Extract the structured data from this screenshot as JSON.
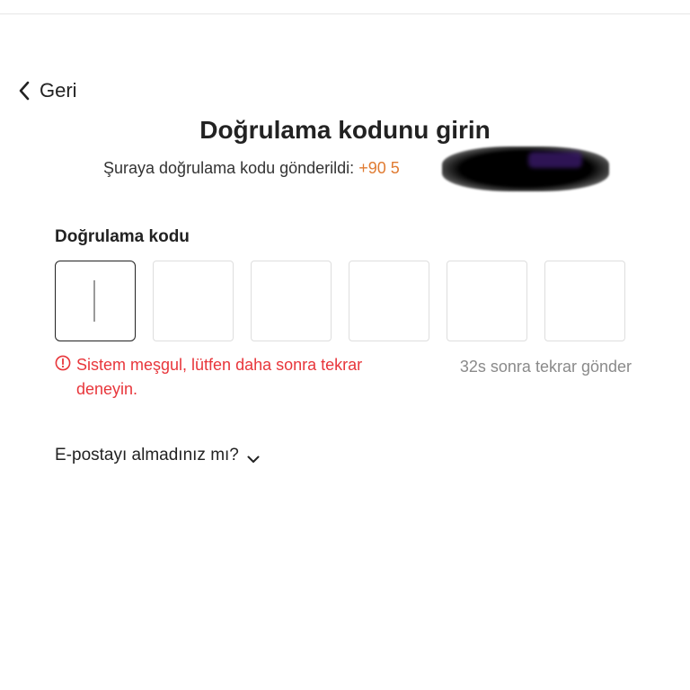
{
  "nav": {
    "back_label": "Geri",
    "back_icon": "chevron-left-icon"
  },
  "header": {
    "title": "Doğrulama kodunu girin",
    "subtitle_prefix": "Şuraya doğrulama kodu gönderildi:",
    "phone_visible": "+90 5"
  },
  "code": {
    "label": "Doğrulama kodu",
    "digits": [
      "",
      "",
      "",
      "",
      "",
      ""
    ],
    "active_index": 0
  },
  "error": {
    "icon": "error-circle-icon",
    "message": "Sistem meşgul, lütfen daha sonra tekrar deneyin."
  },
  "resend": {
    "label": "32s sonra tekrar gönder"
  },
  "help": {
    "label": "E-postayı almadınız mı?",
    "icon": "chevron-down-icon"
  },
  "colors": {
    "text": "#222222",
    "accent_orange": "#e07b32",
    "error_red": "#e8363b",
    "muted": "#8a8a8a",
    "box_border": "#dedede"
  }
}
